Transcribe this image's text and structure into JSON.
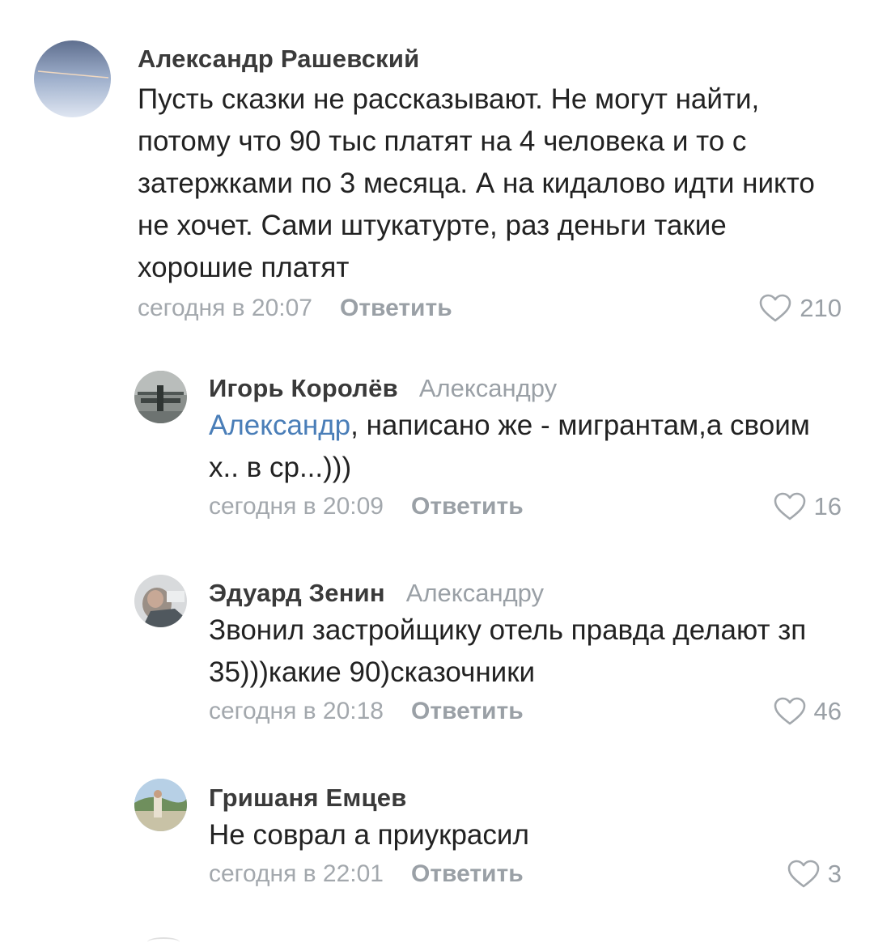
{
  "comments": [
    {
      "author": "Александр Рашевский",
      "reply_to": "",
      "text_parts": [
        {
          "type": "text",
          "value": "Пусть сказки не рассказывают. Не могут найти, потому что 90 тыс платят на 4 человека и то с затержками по 3 месяца. А на кидалово идти никто не хочет. Сами штукатурте, раз деньги такие хорошие платят"
        }
      ],
      "time": "сегодня в 20:07",
      "reply_label": "Ответить",
      "likes": "210",
      "avatar_icon": "avatar-photo"
    },
    {
      "author": "Игорь Королёв",
      "reply_to": "Александру",
      "mention": "Александр",
      "text_rest": ", написано же - мигрантам,а своим х.. в ср...)))",
      "time": "сегодня в 20:09",
      "reply_label": "Ответить",
      "likes": "16",
      "avatar_icon": "avatar-photo"
    },
    {
      "author": "Эдуард Зенин",
      "reply_to": "Александру",
      "text": "Звонил застройщику отель правда делают зп 35)))какие 90)сказочники",
      "time": "сегодня в 20:18",
      "reply_label": "Ответить",
      "likes": "46",
      "avatar_icon": "avatar-photo"
    },
    {
      "author": "Гришаня Емцев",
      "reply_to": "",
      "text": "Не соврал а приукрасил",
      "time": "сегодня в 22:01",
      "reply_label": "Ответить",
      "likes": "3",
      "avatar_icon": "avatar-photo"
    }
  ],
  "icons": {
    "like": "heart-outline-icon"
  },
  "colors": {
    "mention": "#4a7eb8",
    "meta_gray": "#9aa0a6",
    "text": "#222222"
  }
}
